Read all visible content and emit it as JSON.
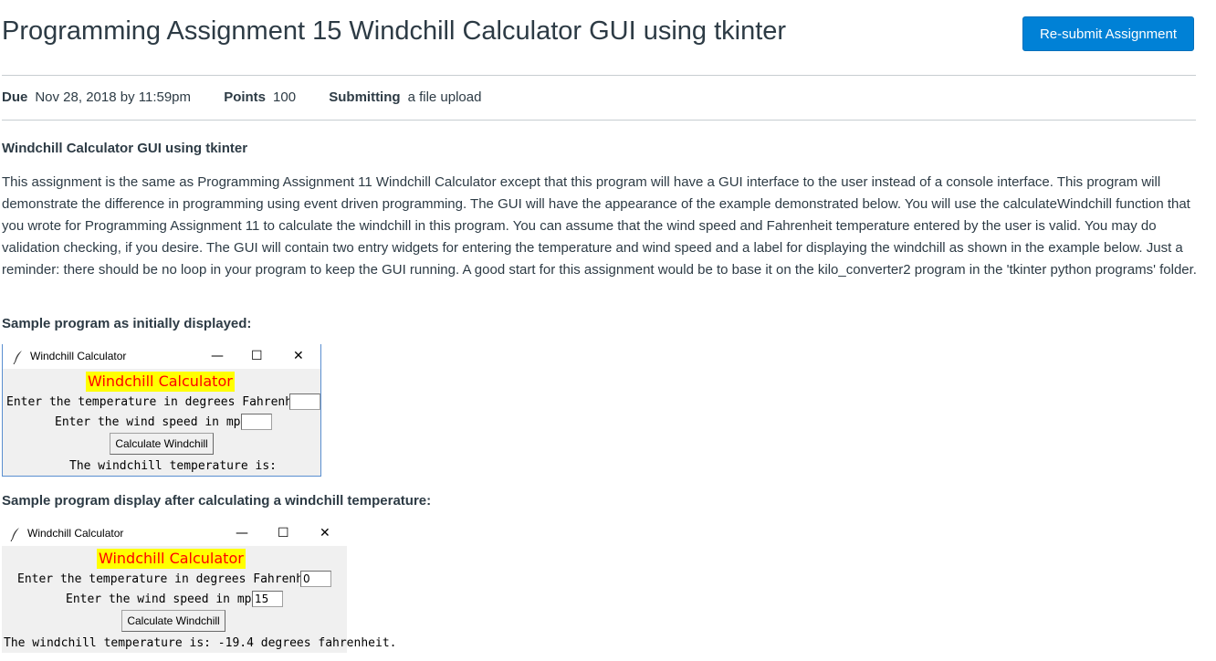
{
  "header": {
    "title": "Programming Assignment 15 Windchill Calculator GUI using tkinter",
    "resubmit_label": "Re-submit Assignment"
  },
  "meta": {
    "due_label": "Due",
    "due_value": "Nov 28, 2018 by 11:59pm",
    "points_label": "Points",
    "points_value": "100",
    "submitting_label": "Submitting",
    "submitting_value": "a file upload"
  },
  "content": {
    "heading": "Windchill Calculator GUI using tkinter",
    "paragraph": "This assignment is the same as Programming Assignment 11 Windchill Calculator except that this program will have a GUI interface to the user instead of a console interface. This program will demonstrate the difference in programming using event driven programming. The GUI will have the appearance of the example demonstrated below. You will use the calculateWindchill function that you wrote for Programming Assignment 11 to calculate the windchill in this program. You can assume that the wind speed and Fahrenheit temperature entered by the user is valid. You may do validation checking, if you desire. The GUI will contain two entry widgets for entering the temperature and wind speed and a label for displaying the windchill as shown in the example below. Just a reminder: there should be no loop in your program to keep the GUI running. A good start for this assignment would be to base it on the kilo_converter2 program in the 'tkinter python programs' folder.",
    "sample1_heading": "Sample program as initially displayed:",
    "sample2_heading": "Sample program display after calculating a windchill temperature:"
  },
  "window1": {
    "title": "Windchill Calculator",
    "app_title": "Windchill Calculator",
    "temp_label": "Enter the temperature in degrees Fahrenheit:",
    "temp_value": "",
    "wind_label": "Enter the wind speed in mph:",
    "wind_value": "",
    "button_label": "Calculate Windchill",
    "result_label": "The windchill temperature is:"
  },
  "window2": {
    "title": "Windchill Calculator",
    "app_title": "Windchill Calculator",
    "temp_label": "Enter the temperature in degrees Fahrenheit:",
    "temp_value": "0",
    "wind_label": "Enter the wind speed in mph:",
    "wind_value": "15",
    "button_label": "Calculate Windchill",
    "result_label": "The windchill temperature is:  -19.4 degrees fahrenheit."
  },
  "window_controls": {
    "minimize": "—",
    "maximize": "☐",
    "close": "✕"
  },
  "icons": {
    "app": "feather-icon",
    "minimize": "minimize-icon",
    "maximize": "maximize-icon",
    "close": "close-icon"
  },
  "colors": {
    "button_primary": "#0081d6",
    "tk_title_bg": "#ffff00",
    "tk_title_fg": "#ff0000",
    "tk_window_bg": "#f0f0f0"
  }
}
